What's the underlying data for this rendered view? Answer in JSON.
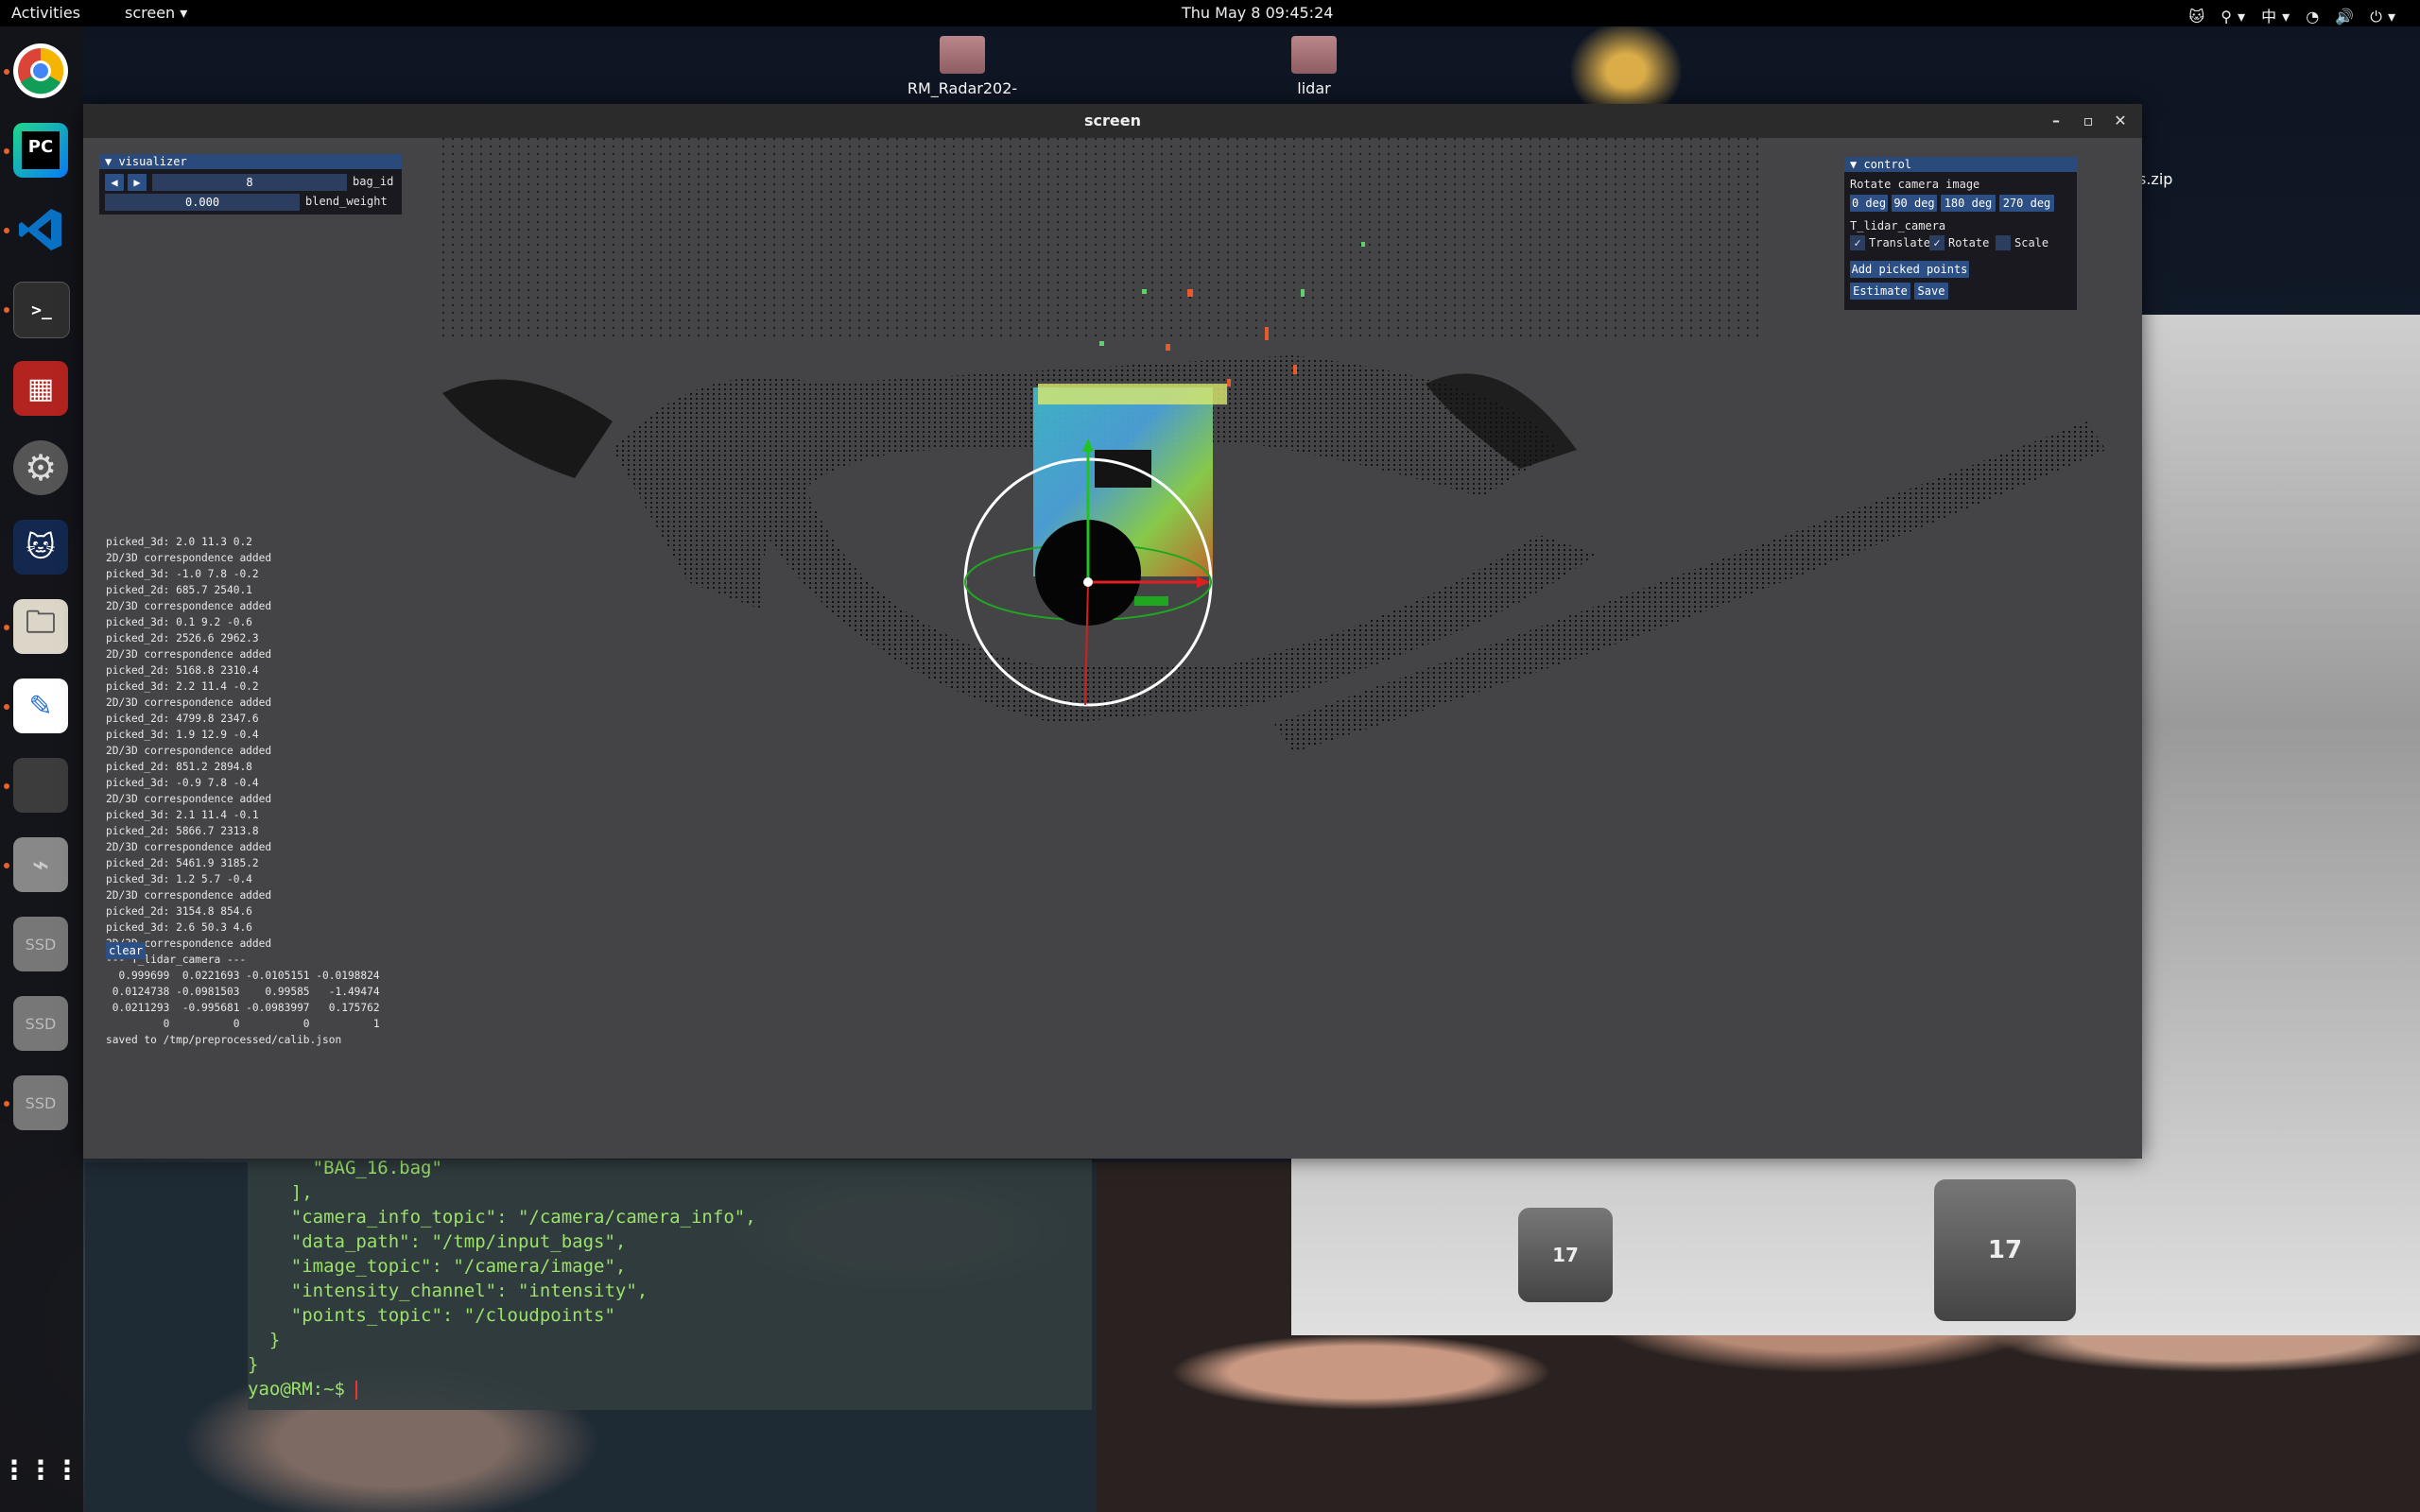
{
  "topbar": {
    "activities": "Activities",
    "app_menu": "screen ▾",
    "clock": "Thu May 8  09:45:24",
    "tray": "🐱  ⚲▾  中▾  ◔ 🔊 ⏻▾"
  },
  "dock": {
    "items": [
      {
        "name": "chrome",
        "glyph": "◉",
        "color": "#e8453c"
      },
      {
        "name": "pycharm",
        "glyph": "PC",
        "color": "#1d9fd7"
      },
      {
        "name": "vscode",
        "glyph": "❯",
        "color": "#0a72c4"
      },
      {
        "name": "terminal",
        "glyph": ">_",
        "color": "#333"
      },
      {
        "name": "app-red",
        "glyph": "▦",
        "color": "#c2322c"
      },
      {
        "name": "settings",
        "glyph": "⚙",
        "color": "#6a6a6a"
      },
      {
        "name": "cat-app",
        "glyph": "🐱",
        "color": "#1c3a6e"
      },
      {
        "name": "files",
        "glyph": "🗀",
        "color": "#d9d2c2"
      },
      {
        "name": "text-editor",
        "glyph": "✎",
        "color": "#2a6fd6"
      },
      {
        "name": "window",
        "glyph": "",
        "color": "#3c3c3c"
      },
      {
        "name": "usb",
        "glyph": "⌁",
        "color": "#888"
      },
      {
        "name": "ssd-1",
        "glyph": "SSD",
        "color": "#777"
      },
      {
        "name": "ssd-2",
        "glyph": "SSD",
        "color": "#777"
      },
      {
        "name": "ssd-3",
        "glyph": "SSD",
        "color": "#777"
      }
    ],
    "apps_grid": "⋮⋮⋮"
  },
  "desktop": {
    "folder1": "RM_Radar202-",
    "folder2": "lidar",
    "zip_label": "s.zip"
  },
  "terminal": {
    "lines": [
      "      \"BAG_16.bag\"",
      "    ],",
      "    \"camera_info_topic\": \"/camera/camera_info\",",
      "    \"data_path\": \"/tmp/input_bags\",",
      "    \"image_topic\": \"/camera/image\",",
      "    \"intensity_channel\": \"intensity\",",
      "    \"points_topic\": \"/cloudpoints\"",
      "  }",
      "}",
      "yao@RM:~$ "
    ]
  },
  "photo": {
    "cube1": "17",
    "cube2": "17"
  },
  "window": {
    "title": "screen",
    "minimize": "–",
    "maximize": "▫",
    "close": "✕"
  },
  "visualizer": {
    "title": "▼ visualizer",
    "prev": "◀",
    "next": "▶",
    "bag_id_value": "8",
    "bag_id_label": "bag_id",
    "blend_value": "0.000",
    "blend_label": "blend_weight"
  },
  "control": {
    "title": "▼ control",
    "rotate_label": "Rotate camera image",
    "rot0": "0 deg",
    "rot90": "90 deg",
    "rot180": "180 deg",
    "rot270": "270 deg",
    "t_label": "T_lidar_camera",
    "translate": "Translate",
    "rotate": "Rotate",
    "scale": "Scale",
    "translate_checked": "✓",
    "rotate_checked": "✓",
    "add_points": "Add picked points",
    "estimate": "Estimate",
    "save": "Save"
  },
  "log": {
    "text": "picked_3d: 2.0 11.3 0.2\n2D/3D correspondence added\npicked_3d: -1.0 7.8 -0.2\npicked_2d: 685.7 2540.1\n2D/3D correspondence added\npicked_3d: 0.1 9.2 -0.6\npicked_2d: 2526.6 2962.3\n2D/3D correspondence added\npicked_2d: 5168.8 2310.4\npicked_3d: 2.2 11.4 -0.2\n2D/3D correspondence added\npicked_2d: 4799.8 2347.6\npicked_3d: 1.9 12.9 -0.4\n2D/3D correspondence added\npicked_2d: 851.2 2894.8\npicked_3d: -0.9 7.8 -0.4\n2D/3D correspondence added\npicked_3d: 2.1 11.4 -0.1\npicked_2d: 5866.7 2313.8\n2D/3D correspondence added\npicked_2d: 5461.9 3185.2\npicked_3d: 1.2 5.7 -0.4\n2D/3D correspondence added\npicked_2d: 3154.8 854.6\npicked_3d: 2.6 50.3 4.6\n2D/3D correspondence added\n--- T_lidar_camera ---\n  0.999699  0.0221693 -0.0105151 -0.0198824\n 0.0124738 -0.0981503    0.99585   -1.49474\n 0.0211293  -0.995681 -0.0983997   0.175762\n         0          0          0          1\nsaved to /tmp/preprocessed/calib.json",
    "clear": "clear"
  }
}
